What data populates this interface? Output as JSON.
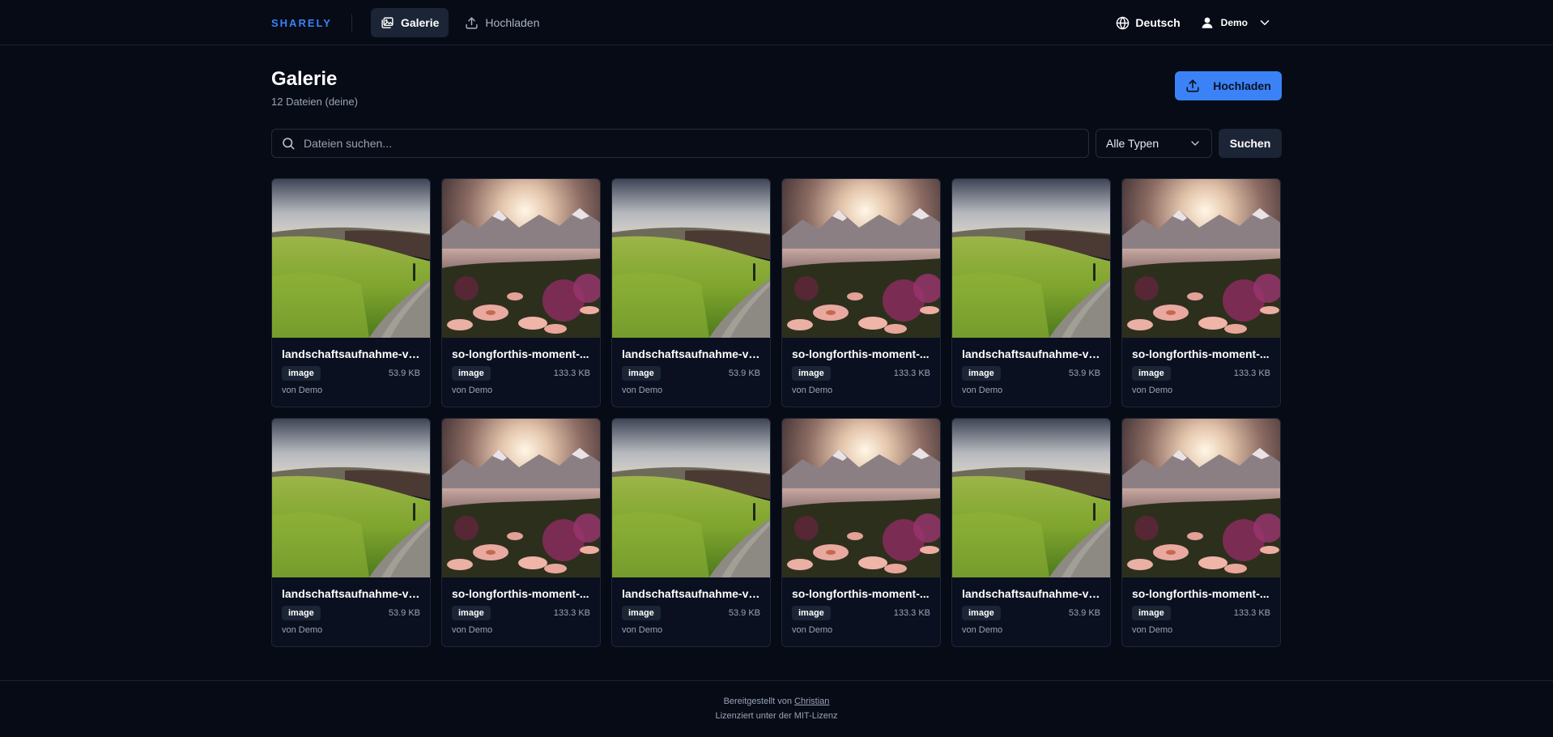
{
  "nav": {
    "brand": "SHARELY",
    "items": [
      {
        "label": "Galerie",
        "icon": "gallery-icon",
        "active": true
      },
      {
        "label": "Hochladen",
        "icon": "upload-icon",
        "active": false
      }
    ],
    "language": "Deutsch",
    "user": "Demo"
  },
  "header": {
    "title": "Galerie",
    "subtitle": "12 Dateien (deine)",
    "upload_label": "Hochladen"
  },
  "search": {
    "placeholder": "Dateien suchen...",
    "value": "",
    "type_filter": "Alle Typen",
    "button_label": "Suchen"
  },
  "files": [
    {
      "name": "landschaftsaufnahme-vo...",
      "type": "image",
      "size": "53.9 KB",
      "owner": "von Demo",
      "thumb": "meadow"
    },
    {
      "name": "so-longforthis-moment-...",
      "type": "image",
      "size": "133.3 KB",
      "owner": "von Demo",
      "thumb": "mountain"
    },
    {
      "name": "landschaftsaufnahme-vo...",
      "type": "image",
      "size": "53.9 KB",
      "owner": "von Demo",
      "thumb": "meadow"
    },
    {
      "name": "so-longforthis-moment-...",
      "type": "image",
      "size": "133.3 KB",
      "owner": "von Demo",
      "thumb": "mountain"
    },
    {
      "name": "landschaftsaufnahme-vo...",
      "type": "image",
      "size": "53.9 KB",
      "owner": "von Demo",
      "thumb": "meadow"
    },
    {
      "name": "so-longforthis-moment-...",
      "type": "image",
      "size": "133.3 KB",
      "owner": "von Demo",
      "thumb": "mountain"
    },
    {
      "name": "landschaftsaufnahme-vo...",
      "type": "image",
      "size": "53.9 KB",
      "owner": "von Demo",
      "thumb": "meadow"
    },
    {
      "name": "so-longforthis-moment-...",
      "type": "image",
      "size": "133.3 KB",
      "owner": "von Demo",
      "thumb": "mountain"
    },
    {
      "name": "landschaftsaufnahme-vo...",
      "type": "image",
      "size": "53.9 KB",
      "owner": "von Demo",
      "thumb": "meadow"
    },
    {
      "name": "so-longforthis-moment-...",
      "type": "image",
      "size": "133.3 KB",
      "owner": "von Demo",
      "thumb": "mountain"
    },
    {
      "name": "landschaftsaufnahme-vo...",
      "type": "image",
      "size": "53.9 KB",
      "owner": "von Demo",
      "thumb": "meadow"
    },
    {
      "name": "so-longforthis-moment-...",
      "type": "image",
      "size": "133.3 KB",
      "owner": "von Demo",
      "thumb": "mountain"
    }
  ],
  "footer": {
    "provided_by": "Bereitgestellt von",
    "author": "Christian",
    "license": "Lizenziert unter der MIT-Lizenz"
  },
  "colors": {
    "background": "#060b16",
    "accent": "#3b82f6",
    "surface": "#1c2535"
  }
}
